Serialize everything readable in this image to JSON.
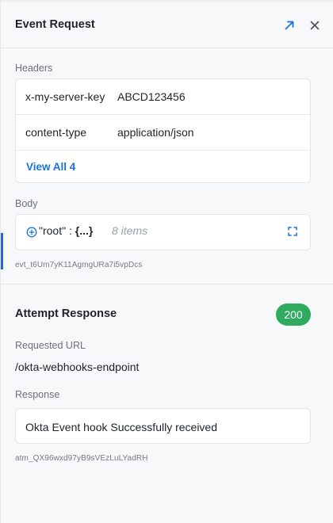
{
  "panel": {
    "title": "Event Request"
  },
  "icons": {
    "open": "arrow-up-right-icon",
    "close": "close-icon",
    "expand_json": "plus-circle-icon",
    "fullscreen": "fullscreen-icon"
  },
  "headers_section": {
    "label": "Headers",
    "rows": [
      {
        "key": "x-my-server-key",
        "value": "ABCD123456"
      },
      {
        "key": "content-type",
        "value": "application/json"
      }
    ],
    "view_all": "View All 4"
  },
  "body_section": {
    "label": "Body",
    "root_key": "\"root\"",
    "colon": ":",
    "collapsed": "{...}",
    "item_count": "8 items"
  },
  "event_id": "evt_t6Um7yK11AgmgURa7i5vpDcs",
  "attempt": {
    "title": "Attempt Response",
    "status_code": "200",
    "requested_url_label": "Requested URL",
    "requested_url": "/okta-webhooks-endpoint",
    "response_label": "Response",
    "response_body": "Okta Event hook Successfully received",
    "attempt_id": "atm_QX96wxd97yB9sVEzLuLYadRH"
  },
  "colors": {
    "accent_blue": "#1a73d9",
    "status_success": "#2eab5f",
    "text": "#1f2328",
    "muted": "#6b7178"
  }
}
